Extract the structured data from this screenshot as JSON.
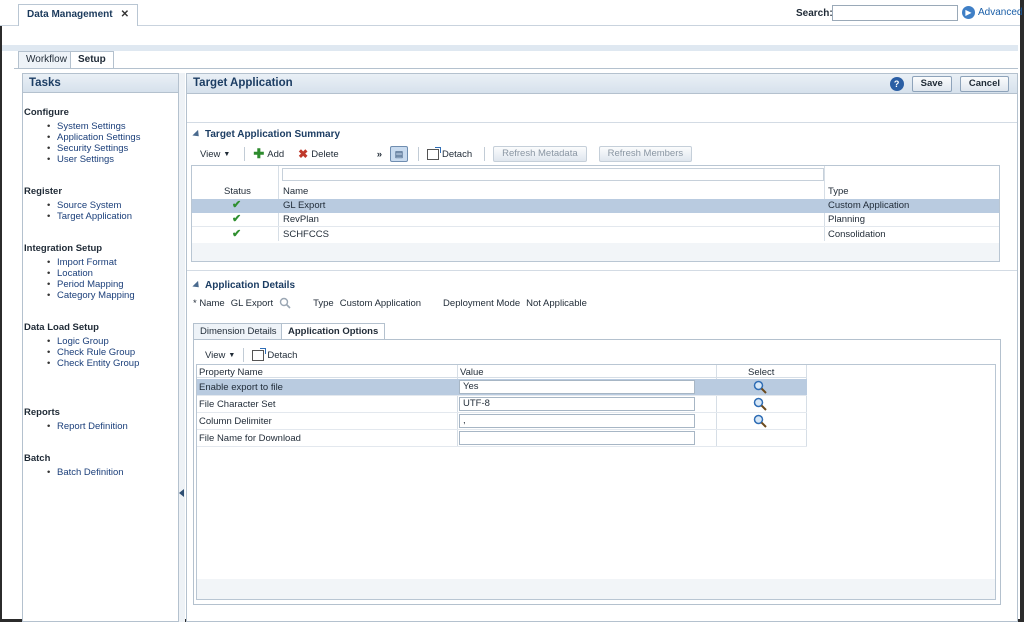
{
  "doc_tab": {
    "label": "Data Management",
    "close": "✕"
  },
  "search": {
    "label": "Search:",
    "value": "",
    "advanced": "Advanced"
  },
  "main_tabs": [
    {
      "label": "Workflow"
    },
    {
      "label": "Setup"
    }
  ],
  "tasks": {
    "title": "Tasks",
    "groups": [
      {
        "label": "Configure",
        "items": [
          "System Settings",
          "Application Settings",
          "Security Settings",
          "User Settings"
        ]
      },
      {
        "label": "Register",
        "items": [
          "Source System",
          "Target Application"
        ]
      },
      {
        "label": "Integration Setup",
        "items": [
          "Import Format",
          "Location",
          "Period Mapping",
          "Category Mapping"
        ]
      },
      {
        "label": "Data Load Setup",
        "items": [
          "Logic Group",
          "Check Rule Group",
          "Check Entity Group"
        ]
      },
      {
        "label": "Reports",
        "items": [
          "Report Definition"
        ]
      },
      {
        "label": "Batch",
        "items": [
          "Batch Definition"
        ]
      }
    ]
  },
  "page": {
    "title": "Target Application",
    "help": "?",
    "save": "Save",
    "cancel": "Cancel"
  },
  "summary": {
    "title": "Target Application Summary",
    "toolbar": {
      "view": "View",
      "add": "Add",
      "delete": "Delete",
      "more": "»",
      "detach": "Detach",
      "refresh_metadata": "Refresh Metadata",
      "refresh_members": "Refresh Members"
    },
    "columns": {
      "status": "Status",
      "name": "Name",
      "type": "Type"
    },
    "rows": [
      {
        "status": "✔",
        "name": "GL Export",
        "type": "Custom Application"
      },
      {
        "status": "✔",
        "name": "RevPlan",
        "type": "Planning"
      },
      {
        "status": "✔",
        "name": "SCHFCCS",
        "type": "Consolidation"
      }
    ]
  },
  "details": {
    "title": "Application Details",
    "name_label": "* Name",
    "name_value": "GL Export",
    "type_label": "Type",
    "type_value": "Custom Application",
    "deploy_label": "Deployment Mode",
    "deploy_value": "Not Applicable",
    "tabs": [
      {
        "label": "Dimension Details"
      },
      {
        "label": "Application Options"
      }
    ],
    "toolbar": {
      "view": "View",
      "detach": "Detach"
    },
    "columns": {
      "property": "Property Name",
      "value": "Value",
      "select": "Select"
    },
    "rows": [
      {
        "property": "Enable export to file",
        "value": "Yes"
      },
      {
        "property": "File Character Set",
        "value": "UTF-8"
      },
      {
        "property": "Column Delimiter",
        "value": ","
      },
      {
        "property": "File Name for Download",
        "value": ""
      }
    ]
  },
  "colors": {
    "accent": "#1c3d63",
    "selected_row": "#b9cbe0",
    "check": "#2f8f2f"
  }
}
